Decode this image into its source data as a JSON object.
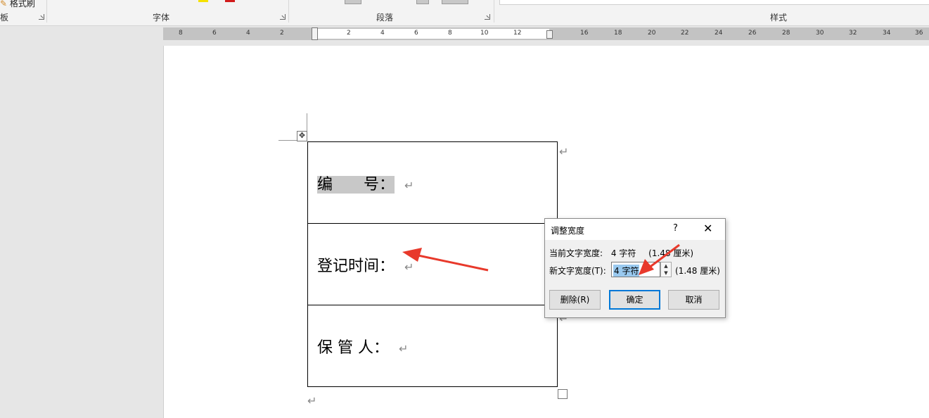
{
  "ribbon": {
    "format_painter": "格式刷",
    "groups": [
      {
        "label": "板"
      },
      {
        "label": "字体"
      },
      {
        "label": "段落"
      },
      {
        "label": "样式"
      }
    ],
    "colors": {
      "highlight": "#f5e100",
      "font_red": "#d11a1a"
    }
  },
  "ruler": {
    "labels": [
      "8",
      "6",
      "4",
      "2",
      "2",
      "4",
      "6",
      "8",
      "10",
      "12",
      "16",
      "18",
      "20",
      "22",
      "24",
      "26",
      "28",
      "30",
      "32",
      "34",
      "36"
    ]
  },
  "document": {
    "rows": [
      {
        "text": "编　　号："
      },
      {
        "text": "登记时间："
      },
      {
        "text": "保 管 人："
      }
    ],
    "paragraph_mark": "↵"
  },
  "dialog": {
    "title": "调整宽度",
    "help": "?",
    "close": "✕",
    "current_label": "当前文字宽度:",
    "current_value": "4 字符",
    "current_cm": "(1.48 厘米)",
    "new_label": "新文字宽度(T):",
    "new_value": "4 字符",
    "new_cm": "(1.48 厘米)",
    "buttons": {
      "delete": "删除(R)",
      "ok": "确定",
      "cancel": "取消"
    }
  },
  "annotation_color": "#e8392b"
}
